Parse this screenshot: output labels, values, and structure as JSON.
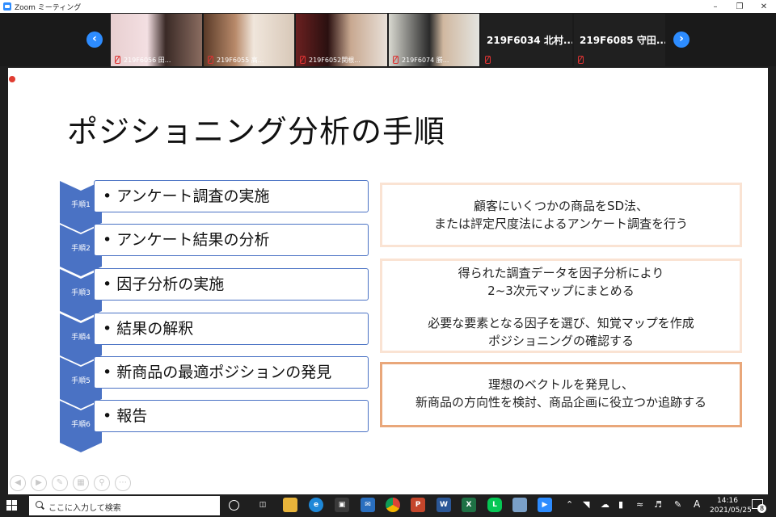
{
  "window": {
    "title": "Zoom ミーティング",
    "controls": [
      "minimize-icon",
      "restore-icon",
      "close-icon"
    ]
  },
  "gallery": {
    "prev_icon": "chevron-left-icon",
    "next_icon": "chevron-right-icon",
    "participants": [
      {
        "name": "219F6056 田..."
      },
      {
        "name": "219F6055 高..."
      },
      {
        "name": "219F6052関根..."
      },
      {
        "name": "219F6074 勝..."
      },
      {
        "name": "219F6034 北村..."
      },
      {
        "name": "219F6085 守田..."
      }
    ]
  },
  "slide": {
    "title": "ポジショニング分析の手順",
    "steps": [
      {
        "tag": "手順1",
        "label": "• アンケート調査の実施"
      },
      {
        "tag": "手順2",
        "label": "• アンケート結果の分析"
      },
      {
        "tag": "手順3",
        "label": "• 因子分析の実施"
      },
      {
        "tag": "手順4",
        "label": "• 結果の解釈"
      },
      {
        "tag": "手順5",
        "label": "• 新商品の最適ポジションの発見"
      },
      {
        "tag": "手順6",
        "label": "• 報告"
      }
    ],
    "descriptions": [
      {
        "lines": [
          "顧客にいくつかの商品をSD法、",
          "または評定尺度法によるアンケート調査を行う"
        ]
      },
      {
        "lines": [
          "得られた調査データを因子分析により",
          "2~3次元マップにまとめる",
          "",
          "必要な要素となる因子を選び、知覚マップを作成",
          "ポジショニングの確認する"
        ]
      },
      {
        "lines": [
          "理想のベクトルを発見し、",
          "新商品の方向性を検討、商品企画に役立つか追跡する"
        ]
      }
    ],
    "colors": {
      "chevron": "#4a72c4",
      "box_light": "#fae3d3",
      "box_strong": "#e9a77a"
    }
  },
  "taskbar": {
    "search_placeholder": "ここに入力して検索",
    "ime": "A",
    "time": "14:16",
    "date": "2021/05/25",
    "notifications": "8"
  }
}
